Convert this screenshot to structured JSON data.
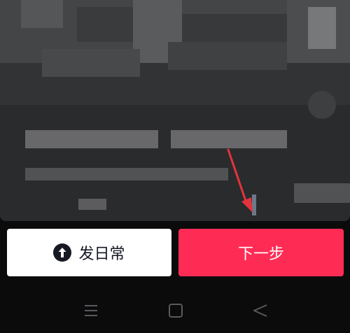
{
  "actions": {
    "post_daily_label": "发日常",
    "next_label": "下一步"
  },
  "colors": {
    "primary": "#fe2c55",
    "secondary_bg": "#ffffff",
    "annotation_arrow": "#e3343b"
  },
  "icons": {
    "post_daily": "arrow-up-circle-icon",
    "nav_menu": "menu-icon",
    "nav_home": "home-square-icon",
    "nav_back": "back-triangle-icon",
    "annotation": "red-arrow-icon"
  }
}
